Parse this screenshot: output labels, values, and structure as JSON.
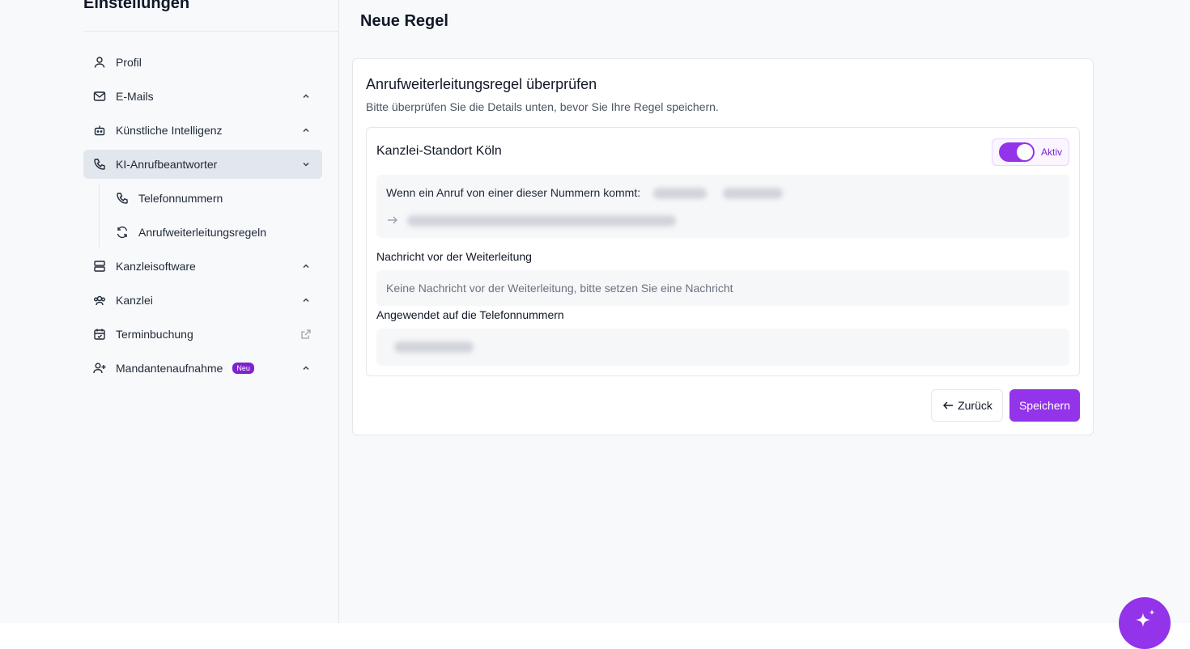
{
  "sidebar": {
    "title": "Einstellungen",
    "items": [
      {
        "label": "Profil"
      },
      {
        "label": "E-Mails"
      },
      {
        "label": "Künstliche Intelligenz"
      },
      {
        "label": "KI-Anrufbeantworter"
      },
      {
        "label": "Kanzleisoftware"
      },
      {
        "label": "Kanzlei"
      },
      {
        "label": "Terminbuchung"
      },
      {
        "label": "Mandantenaufnahme",
        "badge": "Neu"
      }
    ],
    "sub_items": [
      {
        "label": "Telefonnummern"
      },
      {
        "label": "Anrufweiterleitungsregeln"
      }
    ]
  },
  "page": {
    "title": "Neue Regel"
  },
  "card": {
    "title": "Anrufweiterleitungsregel überprüfen",
    "subtitle": "Bitte überprüfen Sie die Details unten, bevor Sie Ihre Regel speichern.",
    "rule": {
      "name": "Kanzlei-Standort Köln",
      "toggle_label": "Aktiv",
      "condition_text": "Wenn ein Anruf von einer dieser Nummern kommt:",
      "message_label": "Nachricht vor der Weiterleitung",
      "message_placeholder": "Keine Nachricht vor der Weiterleitung, bitte setzen Sie eine Nachricht",
      "applied_label": "Angewendet auf die Telefonnummern"
    },
    "back_label": "Zurück",
    "save_label": "Speichern"
  },
  "colors": {
    "accent": "#9333ea",
    "active_nav": "#e2e6ed"
  }
}
